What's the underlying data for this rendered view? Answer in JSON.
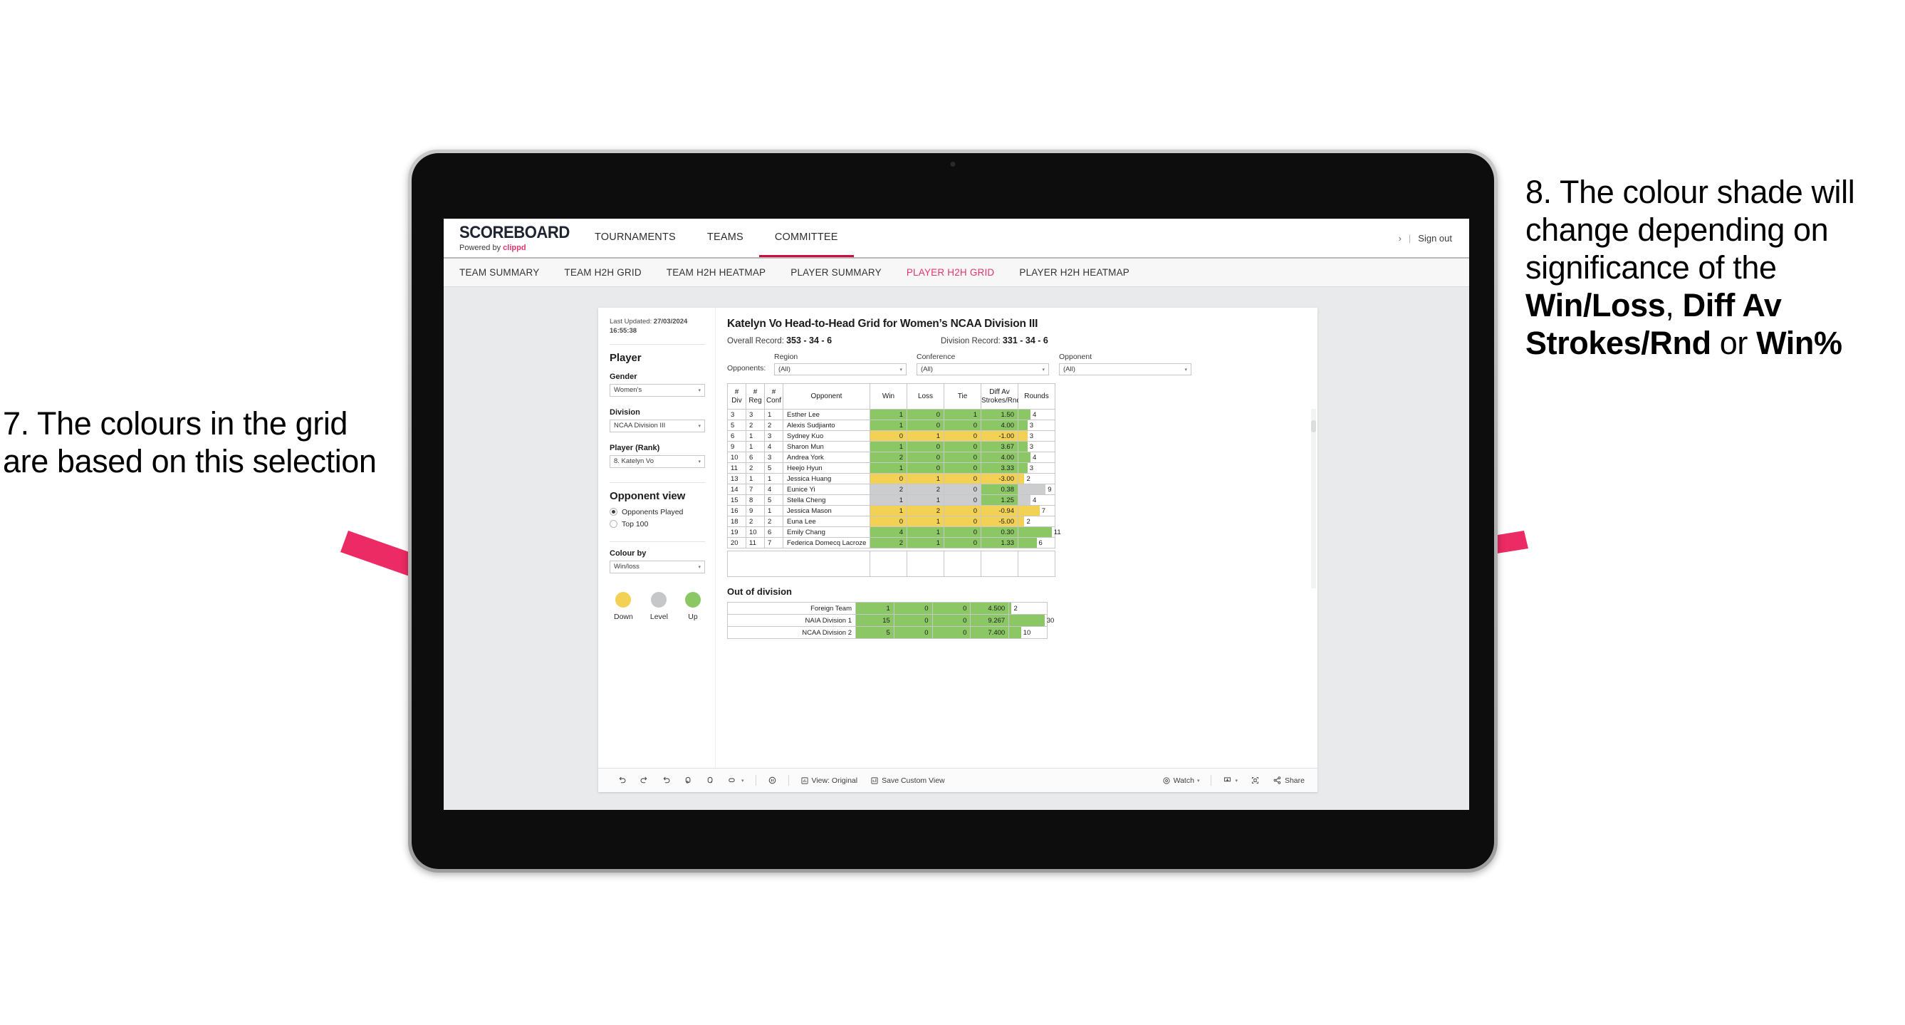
{
  "annotations": {
    "left": "7. The colours in the grid are based on this selection",
    "right_pre": "8. The colour shade will change depending on significance of the ",
    "right_b1": "Win/Loss",
    "right_mid1": ", ",
    "right_b2": "Diff Av Strokes/Rnd",
    "right_mid2": " or ",
    "right_b3": "Win%",
    "arrow_color": "#ec2a63"
  },
  "app": {
    "brand": {
      "title": "SCOREBOARD",
      "powered_prefix": "Powered by ",
      "powered_brand": "clippd"
    },
    "topnav": [
      {
        "label": "TOURNAMENTS",
        "active": false
      },
      {
        "label": "TEAMS",
        "active": false
      },
      {
        "label": "COMMITTEE",
        "active": true
      }
    ],
    "topright": {
      "chevron": "›",
      "divider": "|",
      "signout": "Sign out"
    },
    "subnav": [
      {
        "label": "TEAM SUMMARY",
        "active": false
      },
      {
        "label": "TEAM H2H GRID",
        "active": false
      },
      {
        "label": "TEAM H2H HEATMAP",
        "active": false
      },
      {
        "label": "PLAYER SUMMARY",
        "active": false
      },
      {
        "label": "PLAYER H2H GRID",
        "active": true
      },
      {
        "label": "PLAYER H2H HEATMAP",
        "active": false
      }
    ]
  },
  "filters": {
    "last_updated_label": "Last Updated: ",
    "last_updated_value": "27/03/2024 16:55:38",
    "player_section": "Player",
    "gender_label": "Gender",
    "gender_value": "Women’s",
    "division_label": "Division",
    "division_value": "NCAA Division III",
    "player_rank_label": "Player (Rank)",
    "player_rank_value": "8. Katelyn Vo",
    "opponent_view_label": "Opponent view",
    "opponent_view_options": [
      {
        "label": "Opponents Played",
        "selected": true
      },
      {
        "label": "Top 100",
        "selected": false
      }
    ],
    "colour_by_label": "Colour by",
    "colour_by_value": "Win/loss",
    "legend": [
      {
        "label": "Down",
        "color": "#f2d154"
      },
      {
        "label": "Level",
        "color": "#c5c7c9"
      },
      {
        "label": "Up",
        "color": "#8cc765"
      }
    ],
    "caret": "▾"
  },
  "main": {
    "title": "Katelyn Vo Head-to-Head Grid for Women’s NCAA Division III",
    "overall_record_label": "Overall Record: ",
    "overall_record_value": "353 - 34 - 6",
    "division_record_label": "Division Record: ",
    "division_record_value": "331 - 34 - 6",
    "opponents_label": "Opponents:",
    "opponent_filters": [
      {
        "label": "Region",
        "value": "(All)"
      },
      {
        "label": "Conference",
        "value": "(All)"
      },
      {
        "label": "Opponent",
        "value": "(All)"
      }
    ],
    "columns": [
      "# Div",
      "# Reg",
      "# Conf",
      "Opponent",
      "Win",
      "Loss",
      "Tie",
      "Diff Av Strokes/Rnd",
      "Rounds"
    ],
    "columns_split": [
      {
        "l1": "#",
        "l2": "Div"
      },
      {
        "l1": "#",
        "l2": "Reg"
      },
      {
        "l1": "#",
        "l2": "Conf"
      },
      {
        "l1": "Opponent",
        "l2": ""
      },
      {
        "l1": "Win",
        "l2": ""
      },
      {
        "l1": "Loss",
        "l2": ""
      },
      {
        "l1": "Tie",
        "l2": ""
      },
      {
        "l1": "Diff Av",
        "l2": "Strokes/Rnd"
      },
      {
        "l1": "Rounds",
        "l2": ""
      }
    ],
    "rows": [
      {
        "div": "3",
        "reg": "3",
        "conf": "1",
        "opponent": "Esther Lee",
        "win": "1",
        "loss": "0",
        "tie": "1",
        "diff": "1.50",
        "rounds": "4",
        "rounds_n": 4,
        "color": "#8cc765",
        "diff_color": "#8cc765"
      },
      {
        "div": "5",
        "reg": "2",
        "conf": "2",
        "opponent": "Alexis Sudjianto",
        "win": "1",
        "loss": "0",
        "tie": "0",
        "diff": "4.00",
        "rounds": "3",
        "rounds_n": 3,
        "color": "#8cc765",
        "diff_color": "#8cc765"
      },
      {
        "div": "6",
        "reg": "1",
        "conf": "3",
        "opponent": "Sydney Kuo",
        "win": "0",
        "loss": "1",
        "tie": "0",
        "diff": "-1.00",
        "rounds": "3",
        "rounds_n": 3,
        "color": "#f2d154",
        "diff_color": "#f2d154"
      },
      {
        "div": "9",
        "reg": "1",
        "conf": "4",
        "opponent": "Sharon Mun",
        "win": "1",
        "loss": "0",
        "tie": "0",
        "diff": "3.67",
        "rounds": "3",
        "rounds_n": 3,
        "color": "#8cc765",
        "diff_color": "#8cc765"
      },
      {
        "div": "10",
        "reg": "6",
        "conf": "3",
        "opponent": "Andrea York",
        "win": "2",
        "loss": "0",
        "tie": "0",
        "diff": "4.00",
        "rounds": "4",
        "rounds_n": 4,
        "color": "#8cc765",
        "diff_color": "#8cc765"
      },
      {
        "div": "11",
        "reg": "2",
        "conf": "5",
        "opponent": "Heejo Hyun",
        "win": "1",
        "loss": "0",
        "tie": "0",
        "diff": "3.33",
        "rounds": "3",
        "rounds_n": 3,
        "color": "#8cc765",
        "diff_color": "#8cc765"
      },
      {
        "div": "13",
        "reg": "1",
        "conf": "1",
        "opponent": "Jessica Huang",
        "win": "0",
        "loss": "1",
        "tie": "0",
        "diff": "-3.00",
        "rounds": "2",
        "rounds_n": 2,
        "color": "#f2d154",
        "diff_color": "#f2d154"
      },
      {
        "div": "14",
        "reg": "7",
        "conf": "4",
        "opponent": "Eunice Yi",
        "win": "2",
        "loss": "2",
        "tie": "0",
        "diff": "0.38",
        "rounds": "9",
        "rounds_n": 9,
        "color": "#cccdcf",
        "diff_color": "#8cc765"
      },
      {
        "div": "15",
        "reg": "8",
        "conf": "5",
        "opponent": "Stella Cheng",
        "win": "1",
        "loss": "1",
        "tie": "0",
        "diff": "1.25",
        "rounds": "4",
        "rounds_n": 4,
        "color": "#cccdcf",
        "diff_color": "#8cc765"
      },
      {
        "div": "16",
        "reg": "9",
        "conf": "1",
        "opponent": "Jessica Mason",
        "win": "1",
        "loss": "2",
        "tie": "0",
        "diff": "-0.94",
        "rounds": "7",
        "rounds_n": 7,
        "color": "#f2d154",
        "diff_color": "#f2d154"
      },
      {
        "div": "18",
        "reg": "2",
        "conf": "2",
        "opponent": "Euna Lee",
        "win": "0",
        "loss": "1",
        "tie": "0",
        "diff": "-5.00",
        "rounds": "2",
        "rounds_n": 2,
        "color": "#f2d154",
        "diff_color": "#f2d154"
      },
      {
        "div": "19",
        "reg": "10",
        "conf": "6",
        "opponent": "Emily Chang",
        "win": "4",
        "loss": "1",
        "tie": "0",
        "diff": "0.30",
        "rounds": "11",
        "rounds_n": 11,
        "color": "#8cc765",
        "diff_color": "#8cc765"
      },
      {
        "div": "20",
        "reg": "11",
        "conf": "7",
        "opponent": "Federica Domecq Lacroze",
        "win": "2",
        "loss": "1",
        "tie": "0",
        "diff": "1.33",
        "rounds": "6",
        "rounds_n": 6,
        "color": "#8cc765",
        "diff_color": "#8cc765"
      }
    ],
    "out_of_division_title": "Out of division",
    "out_of_division_rows": [
      {
        "name": "Foreign Team",
        "win": "1",
        "loss": "0",
        "tie": "0",
        "diff": "4.500",
        "rounds": "2",
        "rounds_n": 2,
        "color": "#8cc765"
      },
      {
        "name": "NAIA Division 1",
        "win": "15",
        "loss": "0",
        "tie": "0",
        "diff": "9.267",
        "rounds": "30",
        "rounds_n": 30,
        "color": "#8cc765"
      },
      {
        "name": "NCAA Division 2",
        "win": "5",
        "loss": "0",
        "tie": "0",
        "diff": "7.400",
        "rounds": "10",
        "rounds_n": 10,
        "color": "#8cc765"
      }
    ]
  },
  "toolbar": {
    "view_label": "View: Original",
    "save_label": "Save Custom View",
    "watch_label": "Watch",
    "share_label": "Share",
    "caret": "▾"
  }
}
